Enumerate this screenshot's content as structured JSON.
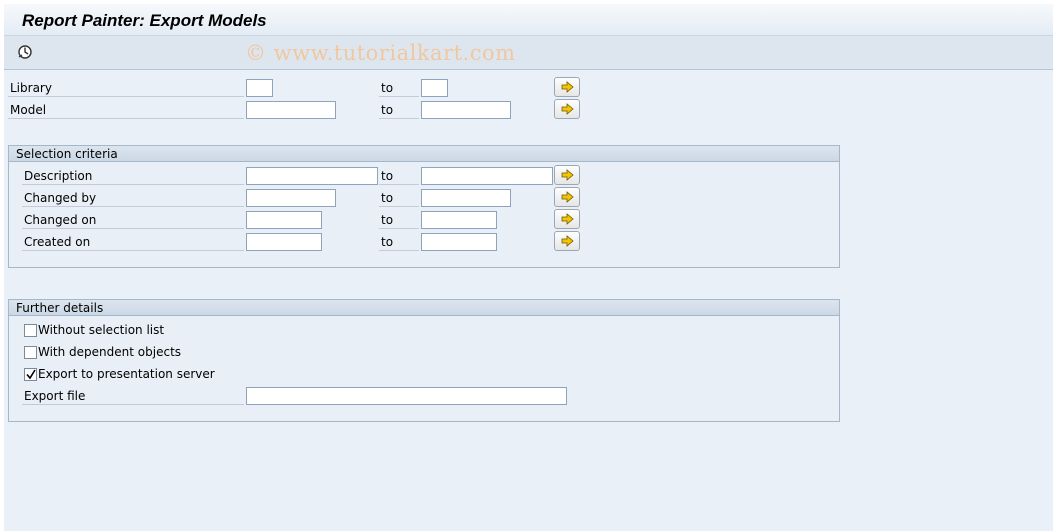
{
  "window": {
    "title": "Report Painter: Export Models"
  },
  "toolbar": {
    "execute_icon": "execute-icon",
    "watermark": "© www.tutorialkart.com"
  },
  "selection": {
    "to_label": "to",
    "library": {
      "label": "Library",
      "from": "",
      "to": ""
    },
    "model": {
      "label": "Model",
      "from": "",
      "to": ""
    }
  },
  "criteria": {
    "title": "Selection criteria",
    "description": {
      "label": "Description",
      "from": "",
      "to": ""
    },
    "changed_by": {
      "label": "Changed by",
      "from": "",
      "to": ""
    },
    "changed_on": {
      "label": "Changed on",
      "from": "",
      "to": ""
    },
    "created_on": {
      "label": "Created on",
      "from": "",
      "to": ""
    }
  },
  "details": {
    "title": "Further details",
    "without_selection_list": {
      "label": "Without selection list",
      "checked": false
    },
    "with_dependent_objects": {
      "label": "With dependent objects",
      "checked": false
    },
    "export_presentation": {
      "label": "Export to presentation server",
      "checked": true
    },
    "export_file": {
      "label": "Export file",
      "value": ""
    }
  },
  "colors": {
    "background": "#eaf0f7",
    "accent_arrow": "#f5c400",
    "group_header": "#cbd8e5"
  }
}
